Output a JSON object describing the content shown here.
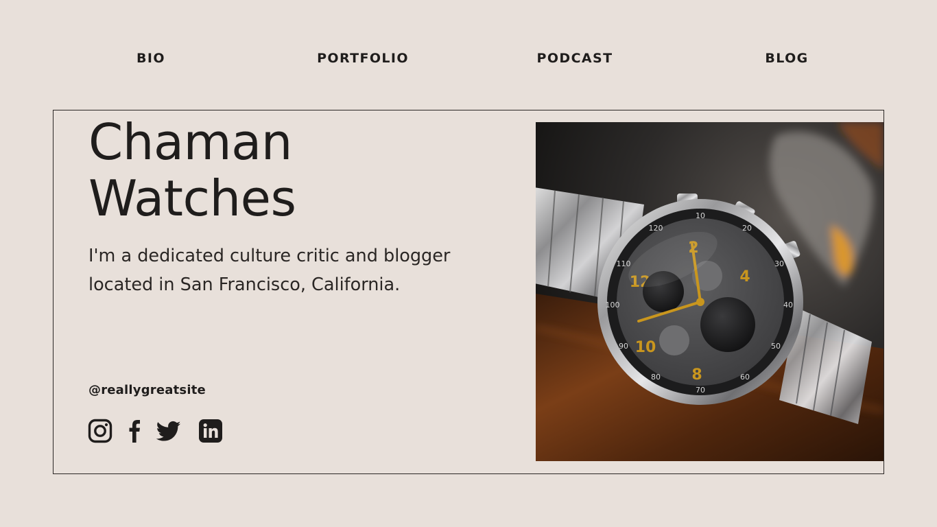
{
  "nav": {
    "items": [
      {
        "label": "BIO"
      },
      {
        "label": "PORTFOLIO"
      },
      {
        "label": "PODCAST"
      },
      {
        "label": "BLOG"
      }
    ]
  },
  "hero": {
    "title_line1": "Chaman",
    "title_line2": "Watches",
    "bio_line1": "I'm a dedicated culture critic and blogger",
    "bio_line2": "located in San Francisco, California.",
    "handle": "@reallygreatsite"
  },
  "social": {
    "icons": [
      "instagram-icon",
      "facebook-icon",
      "twitter-icon",
      "linkedin-icon"
    ]
  },
  "photo": {
    "subject": "chronograph wristwatch on wooden surface",
    "dial_color": "#4a4a4c",
    "accent_color": "#c9961e"
  },
  "colors": {
    "background": "#e8e0da",
    "text": "#1f1d1c"
  }
}
